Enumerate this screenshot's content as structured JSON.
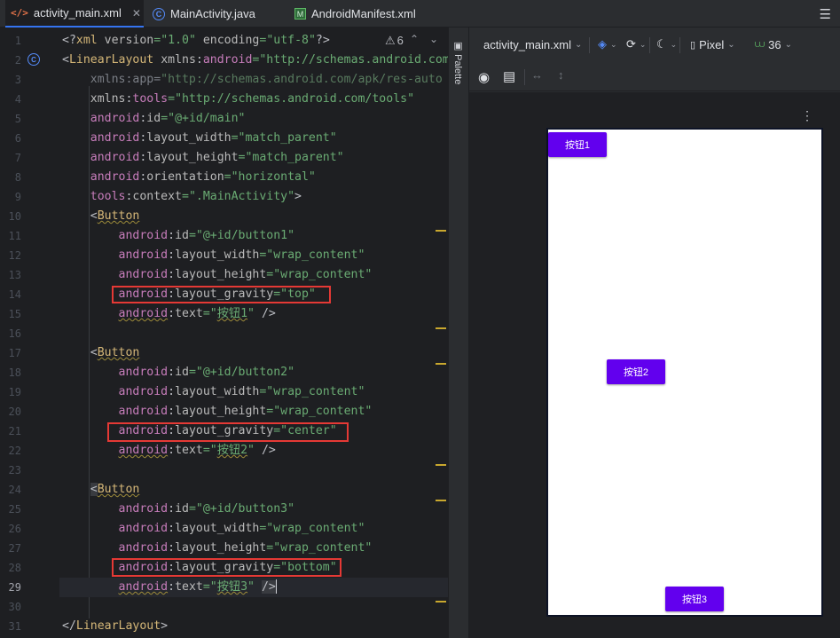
{
  "tabs": [
    {
      "icon": "xml-icon",
      "label": "activity_main.xml",
      "active": true
    },
    {
      "icon": "java-class-icon",
      "label": "MainActivity.java",
      "active": false
    },
    {
      "icon": "manifest-icon",
      "label": "AndroidManifest.xml",
      "active": false
    }
  ],
  "editor": {
    "warning_count": "6",
    "line_numbers": [
      "1",
      "2",
      "3",
      "4",
      "5",
      "6",
      "7",
      "8",
      "9",
      "10",
      "11",
      "12",
      "13",
      "14",
      "15",
      "16",
      "17",
      "18",
      "19",
      "20",
      "21",
      "22",
      "23",
      "24",
      "25",
      "26",
      "27",
      "28",
      "29",
      "30",
      "31"
    ],
    "current_line": "29"
  },
  "palette": {
    "label": "Palette"
  },
  "design": {
    "file": "activity_main.xml",
    "device": "Pixel",
    "api": "36",
    "buttons": [
      "按钮1",
      "按钮2",
      "按钮3"
    ]
  },
  "colors": {
    "accent": "#6200ee",
    "highlight_box": "#e53935",
    "editor_bg": "#1e1f22"
  }
}
